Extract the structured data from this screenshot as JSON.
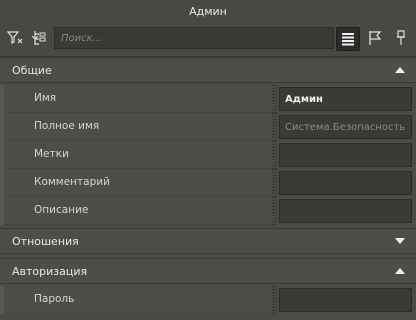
{
  "window": {
    "title": "Админ"
  },
  "toolbar": {
    "search_placeholder": "Поиск...",
    "buttons": [
      "filter-icon",
      "tree-expand-icon",
      "list-view-icon",
      "flag-icon",
      "pin-icon"
    ]
  },
  "sections": {
    "general": {
      "title": "Общие",
      "expanded": true,
      "fields": {
        "name": {
          "label": "Имя",
          "value": "Админ"
        },
        "full_name": {
          "label": "Полное имя",
          "value": "Система.Безопасность.Админ"
        },
        "tags": {
          "label": "Метки",
          "value": ""
        },
        "comment": {
          "label": "Комментарий",
          "value": ""
        },
        "description": {
          "label": "Описание",
          "value": ""
        }
      }
    },
    "relations": {
      "title": "Отношения",
      "expanded": false
    },
    "authorization": {
      "title": "Авторизация",
      "expanded": true,
      "fields": {
        "password": {
          "label": "Пароль",
          "value": ""
        }
      }
    }
  },
  "colors": {
    "background": "#4d4b47",
    "input_background": "#3b3a37",
    "text": "#e6e6e6"
  }
}
